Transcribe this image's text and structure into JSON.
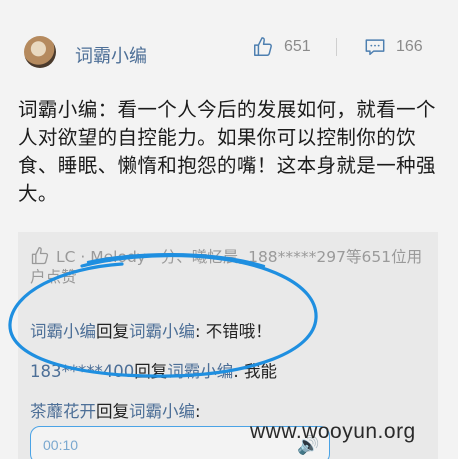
{
  "post": {
    "author": "词霸小编",
    "like_count": "651",
    "comment_count": "166",
    "text": "词霸小编：看一个人今后的发展如何，就看一个人对欲望的自控能力。如果你可以控制你的饮食、睡眠、懒惰和抱怨的嘴！这本身就是一种强大。"
  },
  "likes_summary": "LC · Melody · 分、曦忆晨, 188*****297等651位用户点赞",
  "replies": [
    {
      "from": "词霸小编",
      "verb": "回复",
      "to": "词霸小编",
      "text": ": 不错哦！"
    },
    {
      "from": "183*****400",
      "verb": "回复",
      "to": "词霸小编",
      "text": ": 我能"
    },
    {
      "from": "茶蘼花开",
      "verb": "回复",
      "to": "词霸小编",
      "text": ":"
    }
  ],
  "voice_message": {
    "duration": "00:10",
    "icon": "audio-wave-icon"
  },
  "watermark": "www.wooyun.org",
  "colors": {
    "link": "#4d6f97",
    "highlight_pen": "#1f8fe0",
    "voice_border": "#4aa3e6"
  }
}
